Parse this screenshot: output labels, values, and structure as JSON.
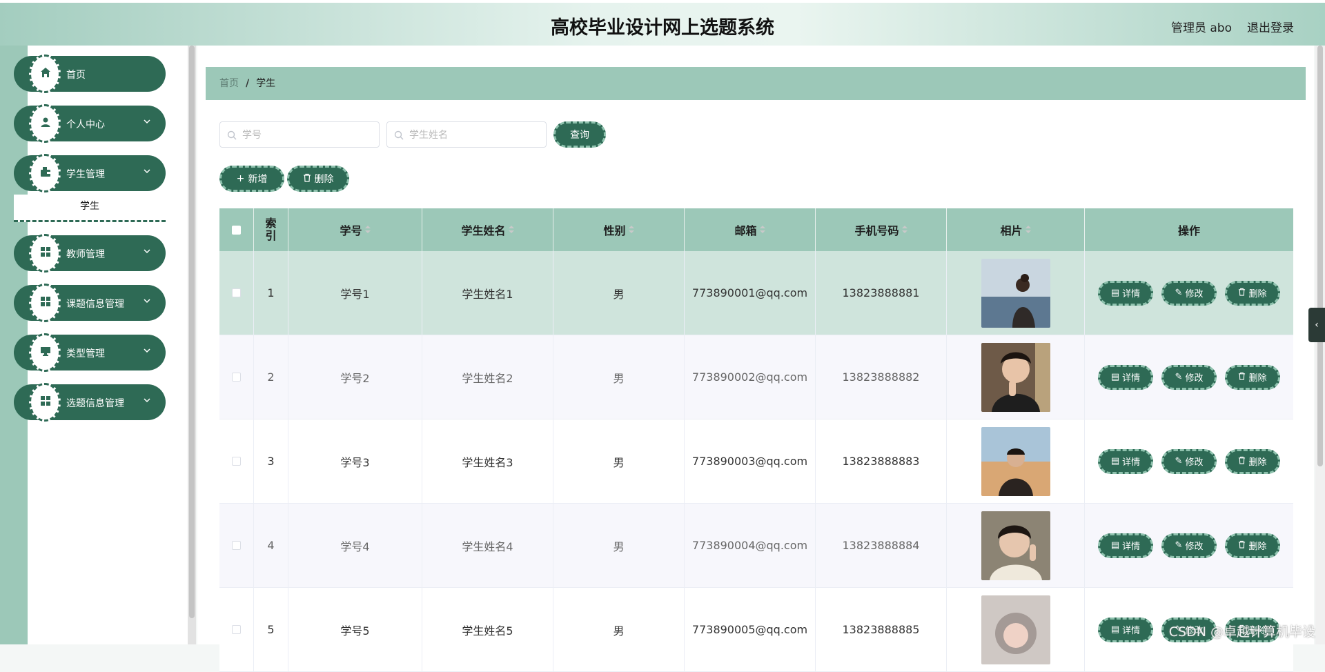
{
  "header": {
    "title": "高校毕业设计网上选题系统",
    "user": "管理员 abo",
    "logout": "退出登录"
  },
  "sidebar": {
    "items": [
      {
        "label": "首页",
        "icon": "home-icon",
        "has_children": false
      },
      {
        "label": "个人中心",
        "icon": "user-icon",
        "has_children": true
      },
      {
        "label": "学生管理",
        "icon": "wallet-icon",
        "has_children": true
      },
      {
        "label": "教师管理",
        "icon": "grid-icon",
        "has_children": true
      },
      {
        "label": "课题信息管理",
        "icon": "grid-icon",
        "has_children": true
      },
      {
        "label": "类型管理",
        "icon": "monitor-icon",
        "has_children": true
      },
      {
        "label": "选题信息管理",
        "icon": "grid-icon",
        "has_children": true
      }
    ],
    "submenu": {
      "label": "学生"
    }
  },
  "breadcrumb": {
    "home": "首页",
    "separator": "/",
    "current": "学生"
  },
  "search": {
    "student_no_placeholder": "学号",
    "student_name_placeholder": "学生姓名",
    "query_label": "查询"
  },
  "actions": {
    "add_label": "新增",
    "delete_label": "删除"
  },
  "table": {
    "columns": [
      "索引",
      "学号",
      "学生姓名",
      "性别",
      "邮箱",
      "手机号码",
      "相片",
      "操作"
    ],
    "row_actions": {
      "detail": "详情",
      "edit": "修改",
      "delete": "删除"
    },
    "rows": [
      {
        "index": "1",
        "no": "学号1",
        "name": "学生姓名1",
        "gender": "男",
        "email": "773890001@qq.com",
        "phone": "13823888881"
      },
      {
        "index": "2",
        "no": "学号2",
        "name": "学生姓名2",
        "gender": "男",
        "email": "773890002@qq.com",
        "phone": "13823888882"
      },
      {
        "index": "3",
        "no": "学号3",
        "name": "学生姓名3",
        "gender": "男",
        "email": "773890003@qq.com",
        "phone": "13823888883"
      },
      {
        "index": "4",
        "no": "学号4",
        "name": "学生姓名4",
        "gender": "男",
        "email": "773890004@qq.com",
        "phone": "13823888884"
      },
      {
        "index": "5",
        "no": "学号5",
        "name": "学生姓名5",
        "gender": "男",
        "email": "773890005@qq.com",
        "phone": "13823888885"
      }
    ]
  },
  "watermark": "CSDN @卓越计算机毕设",
  "colors": {
    "primary": "#2e6a55",
    "header_row": "#9cc8b8",
    "hover_row": "#cfe4dc",
    "stripe_row": "#f7f7fc"
  }
}
